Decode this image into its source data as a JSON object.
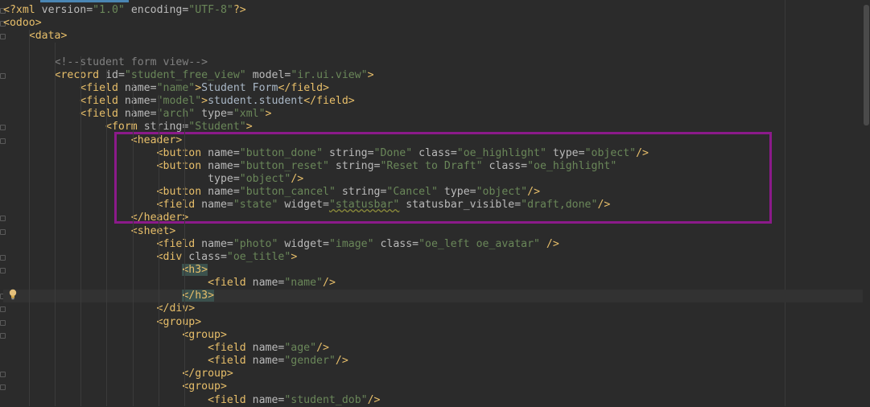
{
  "lines": [
    {
      "indent": 0,
      "parts": [
        [
          "tag",
          "<?xml "
        ],
        [
          "attr",
          "version="
        ],
        [
          "val",
          "\"1.0\""
        ],
        [
          "attr",
          " encoding="
        ],
        [
          "val",
          "\"UTF-8\""
        ],
        [
          "tag",
          "?>"
        ]
      ]
    },
    {
      "indent": 0,
      "parts": [
        [
          "tag",
          "<odoo>"
        ]
      ]
    },
    {
      "indent": 1,
      "parts": [
        [
          "tag",
          "<data>"
        ]
      ]
    },
    {
      "indent": 0,
      "parts": []
    },
    {
      "indent": 2,
      "parts": [
        [
          "cmt",
          "<!--student form view-->"
        ]
      ]
    },
    {
      "indent": 2,
      "parts": [
        [
          "tag",
          "<record "
        ],
        [
          "attr",
          "id="
        ],
        [
          "val",
          "\"student_free_view\""
        ],
        [
          "attr",
          " model="
        ],
        [
          "val",
          "\"ir.ui.view\""
        ],
        [
          "tag",
          ">"
        ]
      ]
    },
    {
      "indent": 3,
      "parts": [
        [
          "tag",
          "<field "
        ],
        [
          "attr",
          "name="
        ],
        [
          "val",
          "\"name\""
        ],
        [
          "tag",
          ">"
        ],
        [
          "txt",
          "Student Form"
        ],
        [
          "tag",
          "</field>"
        ]
      ]
    },
    {
      "indent": 3,
      "parts": [
        [
          "tag",
          "<field "
        ],
        [
          "attr",
          "name="
        ],
        [
          "val",
          "\"model\""
        ],
        [
          "tag",
          ">"
        ],
        [
          "txt",
          "student.student"
        ],
        [
          "tag",
          "</field>"
        ]
      ]
    },
    {
      "indent": 3,
      "parts": [
        [
          "tag",
          "<field "
        ],
        [
          "attr",
          "name="
        ],
        [
          "val",
          "\"arch\""
        ],
        [
          "attr",
          " type="
        ],
        [
          "val",
          "\"xml\""
        ],
        [
          "tag",
          ">"
        ]
      ]
    },
    {
      "indent": 4,
      "parts": [
        [
          "tag",
          "<form "
        ],
        [
          "attr",
          "string="
        ],
        [
          "val",
          "\"Student\""
        ],
        [
          "tag",
          ">"
        ]
      ]
    },
    {
      "indent": 5,
      "parts": [
        [
          "tag",
          "<header>"
        ]
      ]
    },
    {
      "indent": 6,
      "parts": [
        [
          "tag",
          "<button "
        ],
        [
          "attr",
          "name="
        ],
        [
          "val",
          "\"button_done\""
        ],
        [
          "attr",
          " string="
        ],
        [
          "val",
          "\"Done\""
        ],
        [
          "attr",
          " class="
        ],
        [
          "val",
          "\"oe_highlight\""
        ],
        [
          "attr",
          " type="
        ],
        [
          "val",
          "\"object\""
        ],
        [
          "tag",
          "/>"
        ]
      ]
    },
    {
      "indent": 6,
      "parts": [
        [
          "tag",
          "<button "
        ],
        [
          "attr",
          "name="
        ],
        [
          "val",
          "\"button_reset\""
        ],
        [
          "attr",
          " string="
        ],
        [
          "val",
          "\"Reset to Draft\""
        ],
        [
          "attr",
          " class="
        ],
        [
          "val",
          "\"oe_highlight\""
        ]
      ]
    },
    {
      "indent": 8,
      "parts": [
        [
          "attr",
          "type="
        ],
        [
          "val",
          "\"object\""
        ],
        [
          "tag",
          "/>"
        ]
      ]
    },
    {
      "indent": 6,
      "parts": [
        [
          "tag",
          "<button "
        ],
        [
          "attr",
          "name="
        ],
        [
          "val",
          "\"button_cancel\""
        ],
        [
          "attr",
          " string="
        ],
        [
          "val",
          "\"Cancel\""
        ],
        [
          "attr",
          " type="
        ],
        [
          "val",
          "\"object\""
        ],
        [
          "tag",
          "/>"
        ]
      ]
    },
    {
      "indent": 6,
      "parts": [
        [
          "tag",
          "<field "
        ],
        [
          "attr",
          "name="
        ],
        [
          "val",
          "\"state\""
        ],
        [
          "attr",
          " widget="
        ],
        [
          "valsq",
          "\"statusbar\""
        ],
        [
          "attr",
          " statusbar_visible="
        ],
        [
          "val",
          "\"draft,done\""
        ],
        [
          "tag",
          "/>"
        ]
      ]
    },
    {
      "indent": 5,
      "parts": [
        [
          "tag",
          "</header>"
        ]
      ]
    },
    {
      "indent": 5,
      "parts": [
        [
          "tag",
          "<sheet>"
        ]
      ]
    },
    {
      "indent": 6,
      "parts": [
        [
          "tag",
          "<field "
        ],
        [
          "attr",
          "name="
        ],
        [
          "val",
          "\"photo\""
        ],
        [
          "attr",
          " widget="
        ],
        [
          "val",
          "\"image\""
        ],
        [
          "attr",
          " class="
        ],
        [
          "val",
          "\"oe_left oe_avatar\""
        ],
        [
          "tag",
          " />"
        ]
      ]
    },
    {
      "indent": 6,
      "parts": [
        [
          "tag",
          "<div "
        ],
        [
          "attr",
          "class="
        ],
        [
          "val",
          "\"oe_title\""
        ],
        [
          "tag",
          ">"
        ]
      ]
    },
    {
      "indent": 7,
      "parts": [
        [
          "taghl",
          "<h3>"
        ]
      ]
    },
    {
      "indent": 8,
      "parts": [
        [
          "tag",
          "<field "
        ],
        [
          "attr",
          "name="
        ],
        [
          "val",
          "\"name\""
        ],
        [
          "tag",
          "/>"
        ]
      ]
    },
    {
      "indent": 7,
      "parts": [
        [
          "taghl",
          "</h3>"
        ]
      ],
      "current": true
    },
    {
      "indent": 6,
      "parts": [
        [
          "tag",
          "</div>"
        ]
      ]
    },
    {
      "indent": 6,
      "parts": [
        [
          "tag",
          "<group>"
        ]
      ]
    },
    {
      "indent": 7,
      "parts": [
        [
          "tag",
          "<group>"
        ]
      ]
    },
    {
      "indent": 8,
      "parts": [
        [
          "tag",
          "<field "
        ],
        [
          "attr",
          "name="
        ],
        [
          "val",
          "\"age\""
        ],
        [
          "tag",
          "/>"
        ]
      ]
    },
    {
      "indent": 8,
      "parts": [
        [
          "tag",
          "<field "
        ],
        [
          "attr",
          "name="
        ],
        [
          "val",
          "\"gender\""
        ],
        [
          "tag",
          "/>"
        ]
      ]
    },
    {
      "indent": 7,
      "parts": [
        [
          "tag",
          "</group>"
        ]
      ]
    },
    {
      "indent": 7,
      "parts": [
        [
          "tag",
          "<group>"
        ]
      ]
    },
    {
      "indent": 8,
      "parts": [
        [
          "tag",
          "<field "
        ],
        [
          "attr",
          "name="
        ],
        [
          "val",
          "\"student_dob\""
        ],
        [
          "tag",
          "/>"
        ]
      ]
    }
  ],
  "colors": {
    "background": "#2b2b2b",
    "tag": "#e8bf6a",
    "attribute": "#bababa",
    "value": "#6a8759",
    "comment": "#808080",
    "highlight_box": "#8b1a8a"
  },
  "icons": {
    "intention": "lightbulb-icon"
  }
}
